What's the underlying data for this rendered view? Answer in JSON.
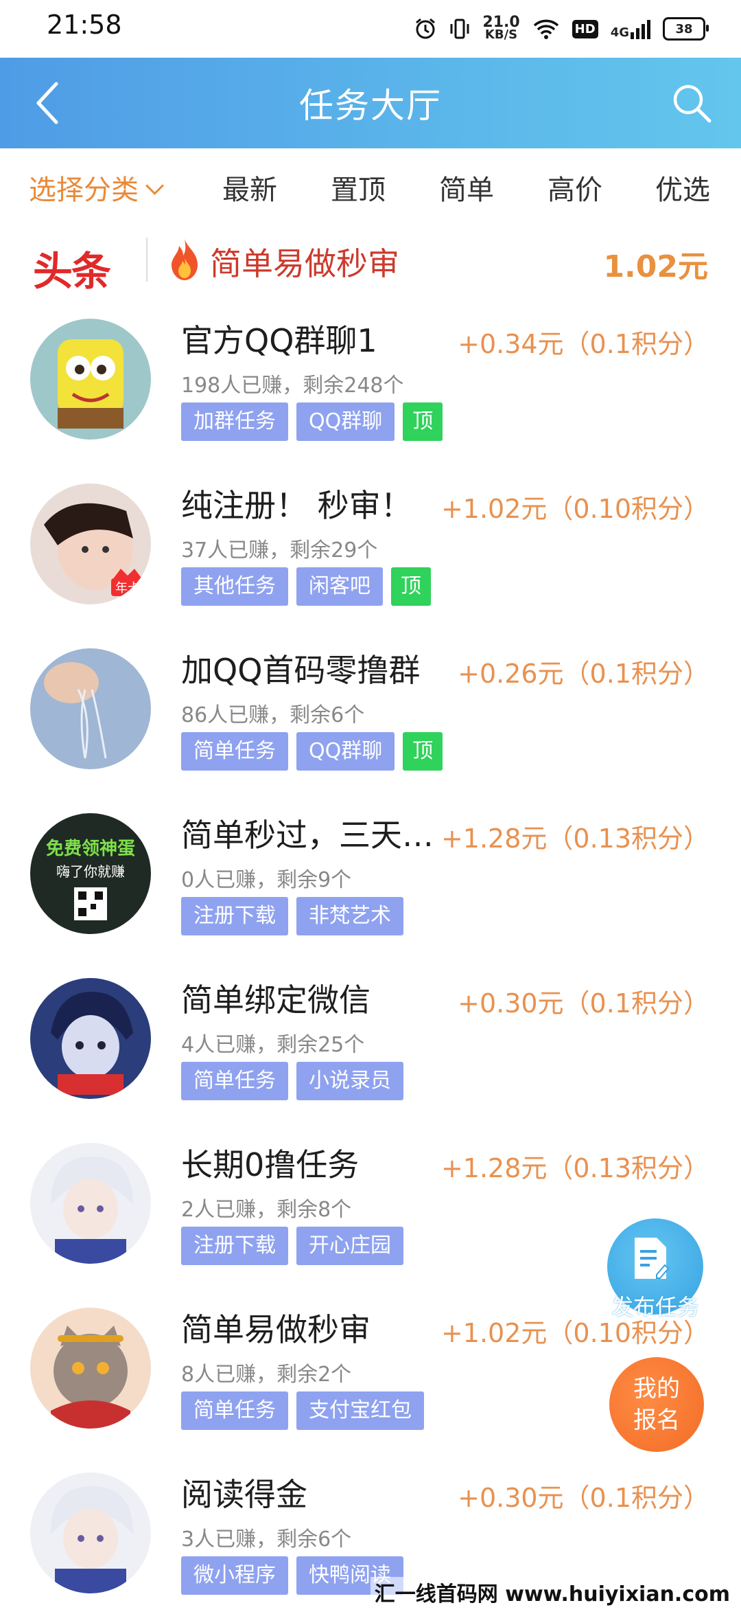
{
  "status_bar": {
    "time": "21:58",
    "net_speed_value": "21.0",
    "net_speed_unit": "KB/S",
    "hd": "HD",
    "network_type": "4G",
    "battery": "38"
  },
  "header": {
    "title": "任务大厅",
    "back_icon": "chevron-left-icon",
    "search_icon": "search-icon"
  },
  "tabs": {
    "category": "选择分类",
    "items": [
      "最新",
      "置顶",
      "简单",
      "高价",
      "优选"
    ]
  },
  "banner": {
    "logo": "头条",
    "title": "简单易做秒审",
    "price": "1.02元"
  },
  "tasks": [
    {
      "title": "官方QQ群聊1",
      "price": "+0.34元（0.1积分）",
      "stats": "198人已赚，剩余248个",
      "tags": [
        "加群任务",
        "QQ群聊",
        "顶"
      ]
    },
    {
      "title": "纯注册！ 秒审！",
      "price": "+1.02元（0.10积分）",
      "stats": "37人已赚，剩余29个",
      "tags": [
        "其他任务",
        "闲客吧",
        "顶"
      ],
      "badge": "年卡"
    },
    {
      "title": "加QQ首码零撸群",
      "price": "+0.26元（0.1积分）",
      "stats": "86人已赚，剩余6个",
      "tags": [
        "简单任务",
        "QQ群聊",
        "顶"
      ]
    },
    {
      "title": "简单秒过，三天…",
      "price": "+1.28元（0.13积分）",
      "stats": "0人已赚，剩余9个",
      "tags": [
        "注册下载",
        "非梵艺术"
      ],
      "avatar_text1": "免费领神蛋",
      "avatar_text2": "嗨了你就赚"
    },
    {
      "title": "简单绑定微信",
      "price": "+0.30元（0.1积分）",
      "stats": "4人已赚，剩余25个",
      "tags": [
        "简单任务",
        "小说录员"
      ]
    },
    {
      "title": "长期0撸任务",
      "price": "+1.28元（0.13积分）",
      "stats": "2人已赚，剩余8个",
      "tags": [
        "注册下载",
        "开心庄园"
      ]
    },
    {
      "title": "简单易做秒审",
      "price": "+1.02元（0.10积分）",
      "stats": "8人已赚，剩余2个",
      "tags": [
        "简单任务",
        "支付宝红包"
      ]
    },
    {
      "title": "阅读得金",
      "price": "+0.30元（0.1积分）",
      "stats": "3人已赚，剩余6个",
      "tags": [
        "微小程序",
        "快鸭阅读"
      ]
    }
  ],
  "fab": {
    "publish_label": "发布任务",
    "join_label": "我的报名"
  },
  "watermark": "汇一线首码网 www.huiyixian.com",
  "colors": {
    "header_start": "#4f9ce6",
    "header_end": "#63c6ec",
    "accent_orange": "#e88a3a",
    "tag_blue": "#8fa2f0",
    "tag_green": "#2fd25a",
    "banner_red": "#cc3a2c"
  }
}
